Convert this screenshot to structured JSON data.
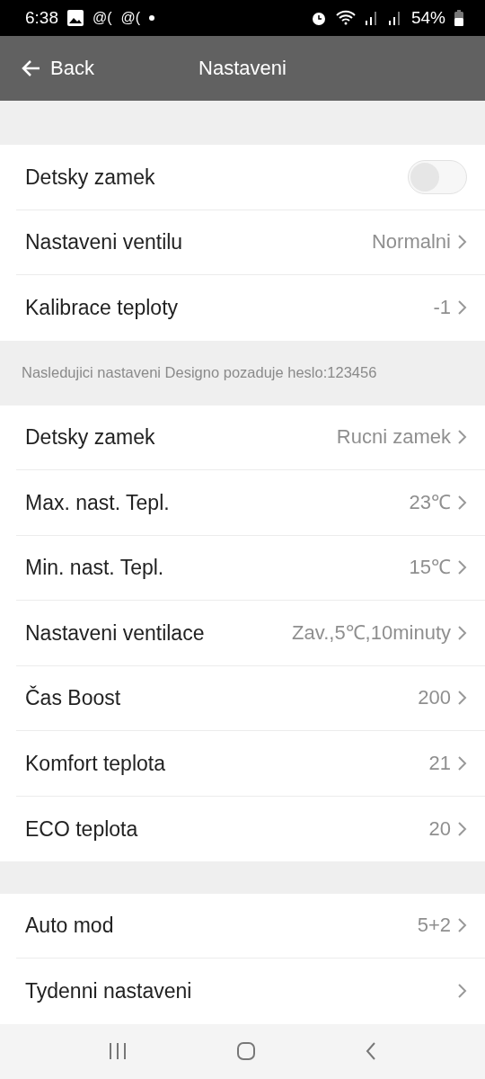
{
  "status_bar": {
    "time": "6:38",
    "notifications": [
      "@(",
      "@("
    ],
    "battery": "54%"
  },
  "header": {
    "back": "Back",
    "title": "Nastaveni"
  },
  "sections": [
    {
      "rows": [
        {
          "kind": "toggle",
          "label": "Detsky zamek",
          "on": false
        },
        {
          "kind": "value",
          "label": "Nastaveni ventilu",
          "value": "Normalni"
        },
        {
          "kind": "value",
          "label": "Kalibrace teploty",
          "value": "-1"
        }
      ]
    },
    {
      "note": "Nasledujici nastaveni Designo pozaduje heslo:123456",
      "rows": [
        {
          "kind": "value",
          "label": "Detsky zamek",
          "value": "Rucni zamek"
        },
        {
          "kind": "value",
          "label": "Max. nast. Tepl.",
          "value": "23℃"
        },
        {
          "kind": "value",
          "label": "Min. nast. Tepl.",
          "value": "15℃"
        },
        {
          "kind": "value",
          "label": "Nastaveni ventilace",
          "value": "Zav.,5℃,10minuty"
        },
        {
          "kind": "value",
          "label": "Čas Boost",
          "value": "200"
        },
        {
          "kind": "value",
          "label": "Komfort teplota",
          "value": "21"
        },
        {
          "kind": "value",
          "label": "ECO teplota",
          "value": "20"
        }
      ]
    },
    {
      "rows": [
        {
          "kind": "value",
          "label": "Auto mod",
          "value": "5+2"
        },
        {
          "kind": "value",
          "label": "Tydenni nastaveni",
          "value": null
        }
      ]
    }
  ]
}
